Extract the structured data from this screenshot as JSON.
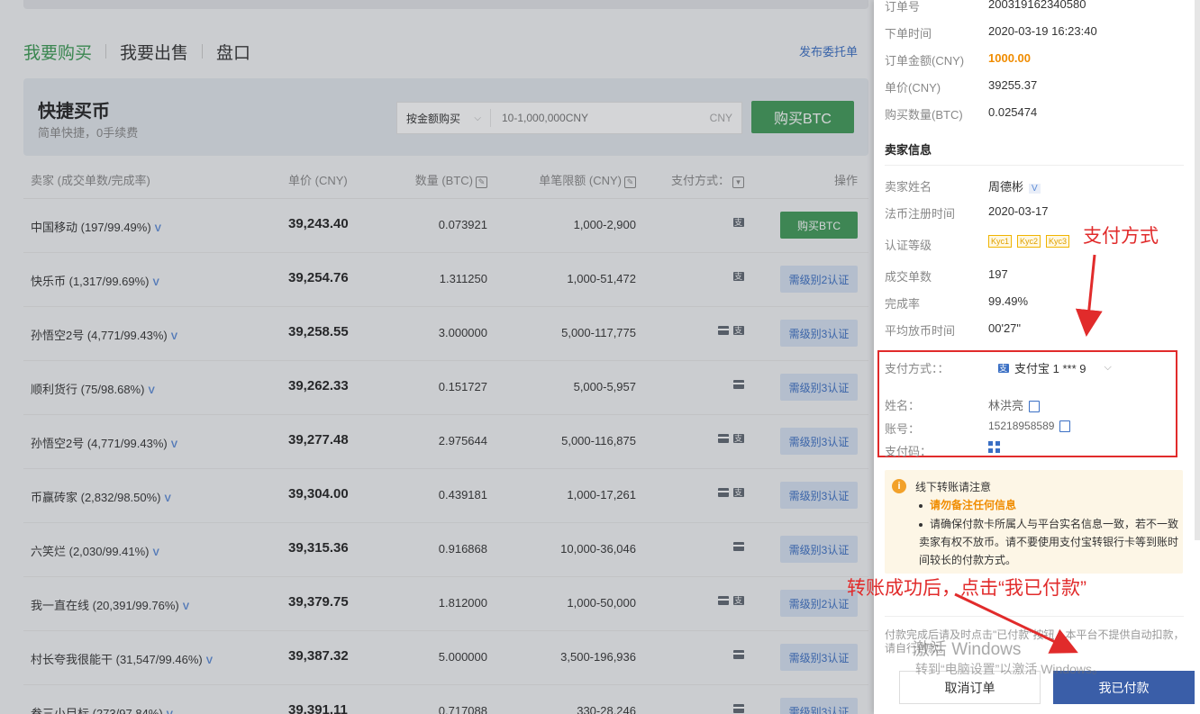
{
  "tabs": {
    "buy": "我要购买",
    "sell": "我要出售",
    "board": "盘口"
  },
  "publish": "发布委托单",
  "quick": {
    "title": "快捷买币",
    "subtitle": "简单快捷，0手续费",
    "mode": "按金额购买",
    "amount_placeholder": "10-1,000,000CNY",
    "unit": "CNY",
    "buy_button": "购买BTC"
  },
  "table": {
    "headers": {
      "seller": "卖家 (成交单数/完成率)",
      "price": "单价 (CNY)",
      "qty": "数量 (BTC)",
      "limit": "单笔限额 (CNY)",
      "pay": "支付方式：",
      "action": "操作"
    },
    "rows": [
      {
        "seller": "中国移动 (197/99.49%)",
        "price": "39,243.40",
        "qty": "0.073921",
        "limit": "1,000-2,900",
        "pay": [
          "ali"
        ],
        "action": "购买BTC",
        "style": "green"
      },
      {
        "seller": "快乐币 (1,317/99.69%)",
        "price": "39,254.76",
        "qty": "1.311250",
        "limit": "1,000-51,472",
        "pay": [
          "ali"
        ],
        "action": "需级别2认证",
        "style": "blue"
      },
      {
        "seller": "孙悟空2号 (4,771/99.43%)",
        "price": "39,258.55",
        "qty": "3.000000",
        "limit": "5,000-117,775",
        "pay": [
          "card",
          "ali"
        ],
        "action": "需级别3认证",
        "style": "blue"
      },
      {
        "seller": "顺利货行 (75/98.68%)",
        "price": "39,262.33",
        "qty": "0.151727",
        "limit": "5,000-5,957",
        "pay": [
          "card"
        ],
        "action": "需级别3认证",
        "style": "blue"
      },
      {
        "seller": "孙悟空2号 (4,771/99.43%)",
        "price": "39,277.48",
        "qty": "2.975644",
        "limit": "5,000-116,875",
        "pay": [
          "card",
          "ali"
        ],
        "action": "需级别3认证",
        "style": "blue"
      },
      {
        "seller": "币赢砖家 (2,832/98.50%)",
        "price": "39,304.00",
        "qty": "0.439181",
        "limit": "1,000-17,261",
        "pay": [
          "card",
          "ali"
        ],
        "action": "需级别3认证",
        "style": "blue"
      },
      {
        "seller": "六笑烂 (2,030/99.41%)",
        "price": "39,315.36",
        "qty": "0.916868",
        "limit": "10,000-36,046",
        "pay": [
          "card"
        ],
        "action": "需级别3认证",
        "style": "blue"
      },
      {
        "seller": "我一直在线 (20,391/99.76%)",
        "price": "39,379.75",
        "qty": "1.812000",
        "limit": "1,000-50,000",
        "pay": [
          "card",
          "ali"
        ],
        "action": "需级别2认证",
        "style": "blue"
      },
      {
        "seller": "村长夸我很能干 (31,547/99.46%)",
        "price": "39,387.32",
        "qty": "5.000000",
        "limit": "3,500-196,936",
        "pay": [
          "card"
        ],
        "action": "需级别3认证",
        "style": "blue"
      },
      {
        "seller": "叁三小目标 (273/97.84%)",
        "price": "39,391.11",
        "qty": "0.717088",
        "limit": "330-28,246",
        "pay": [
          "card"
        ],
        "action": "需级别3认证",
        "style": "blue"
      }
    ]
  },
  "order": {
    "order_no_label": "订单号",
    "order_no": "200319162340580",
    "time_label": "下单时间",
    "time": "2020-03-19 16:23:40",
    "amount_label": "订单金额(CNY)",
    "amount": "1000.00",
    "unit_price_label": "单价(CNY)",
    "unit_price": "39255.37",
    "qty_label": "购买数量(BTC)",
    "qty": "0.025474"
  },
  "seller_info": {
    "section": "卖家信息",
    "name_label": "卖家姓名",
    "name": "周德彬",
    "v": "V",
    "reg_label": "法币注册时间",
    "reg": "2020-03-17",
    "level_label": "认证等级",
    "kyc": [
      "Kyc1",
      "Kyc2",
      "Kyc3"
    ],
    "deals_label": "成交单数",
    "deals": "197",
    "rate_label": "完成率",
    "rate": "99.49%",
    "avg_label": "平均放币时间",
    "avg": "00'27\""
  },
  "payment": {
    "label": "支付方式：：",
    "method": "支付宝 1 *** 9",
    "holder_label": "姓名：",
    "holder": "林洪亮",
    "account_label": "账号：",
    "account": "15218958589",
    "code_label": "支付码："
  },
  "notice": {
    "title": "线下转账请注意",
    "b1": "请勿备注任何信息",
    "b2": "请确保付款卡所属人与平台实名信息一致，若不一致卖家有权不放币。请不要使用支付宝转银行卡等到账时间较长的付款方式。"
  },
  "footer": {
    "note": "付款完成后请及时点击\"已付款\"按钮，本平台不提供自动扣款，请自行付款。",
    "cancel": "取消订单",
    "paid": "我已付款"
  },
  "annotations": {
    "a1": "支付方式",
    "a2": "转账成功后，点击“我已付款”"
  },
  "watermark": {
    "line1": "激活 Windows",
    "line2": "转到“电脑设置”以激活 Windows。"
  },
  "colors": {
    "accent_green": "#3f9a58",
    "accent_blue": "#3a5ea8",
    "annotation_red": "#e12b2b",
    "orange": "#f08c00"
  }
}
